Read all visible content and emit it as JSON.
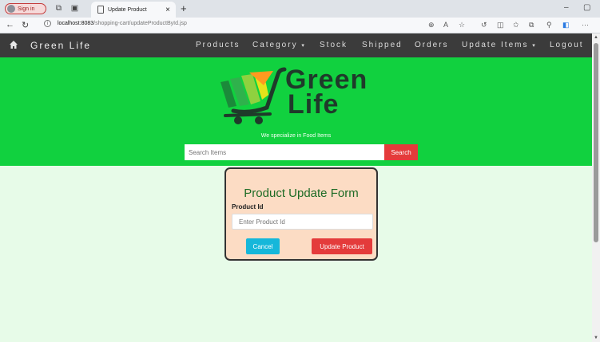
{
  "browser": {
    "signin_label": "Sign in",
    "tab_title": "Update Product",
    "tab_close": "×",
    "new_tab": "+",
    "url_host": "localhost:8083",
    "url_path": "/shopping-cart/updateProductById.jsp",
    "minimize": "–",
    "restore": "▢"
  },
  "navbar": {
    "brand": "Green Life",
    "items": [
      "Products",
      "Category",
      "Stock",
      "Shipped",
      "Orders",
      "Update Items",
      "Logout"
    ],
    "dropdown_caret": "▾"
  },
  "hero": {
    "logo_line1": "Green",
    "logo_line2": "Life",
    "tagline": "We specialize in Food Items",
    "search_placeholder": "Search Items",
    "search_button": "Search"
  },
  "form": {
    "title": "Product Update Form",
    "field_label": "Product Id",
    "field_placeholder": "Enter Product Id",
    "cancel_label": "Cancel",
    "submit_label": "Update Product"
  },
  "colors": {
    "navbar_bg": "#3b3b3b",
    "hero_bg": "#11d13f",
    "page_bg": "#e7fbe8",
    "card_bg": "#fcdcc4",
    "accent_red": "#e43b3b",
    "accent_blue": "#16b7da",
    "title_green": "#1d6b25"
  },
  "icons": {
    "home": "home-icon",
    "info": "info-icon",
    "back": "back-arrow-icon",
    "refresh": "refresh-icon"
  }
}
